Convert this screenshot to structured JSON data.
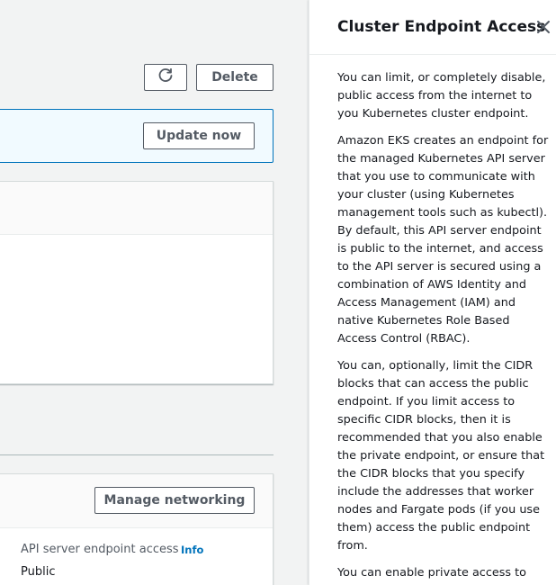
{
  "toolbar": {
    "refresh_icon": "refresh-icon",
    "delete_label": "Delete"
  },
  "update_banner": {
    "update_label": "Update now"
  },
  "networking": {
    "manage_label": "Manage networking",
    "endpoint_access_label": "API server endpoint access",
    "info_label": "Info",
    "endpoint_access_value": "Public"
  },
  "help_panel": {
    "title": "Cluster Endpoint Access",
    "close_icon": "close-icon",
    "paragraphs": [
      "You can limit, or completely disable, public access from the internet to you Kubernetes cluster endpoint.",
      "Amazon EKS creates an endpoint for the managed Kubernetes API server that you use to communicate with your cluster (using Kubernetes management tools such as kubectl). By default, this API server endpoint is public to the internet, and access to the API server is secured using a combination of AWS Identity and Access Management (IAM) and native Kubernetes Role Based Access Control (RBAC).",
      "You can, optionally, limit the CIDR blocks that can access the public endpoint. If you limit access to specific CIDR blocks, then it is recommended that you also enable the private endpoint, or ensure that the CIDR blocks that you specify include the addresses that worker nodes and Fargate pods (if you use them) access the public endpoint from.",
      "You can enable private access to the"
    ]
  },
  "colors": {
    "link": "#0073bb",
    "banner_border": "#0073bb",
    "banner_bg": "#f1faff",
    "page_bg": "#f2f3f3"
  }
}
